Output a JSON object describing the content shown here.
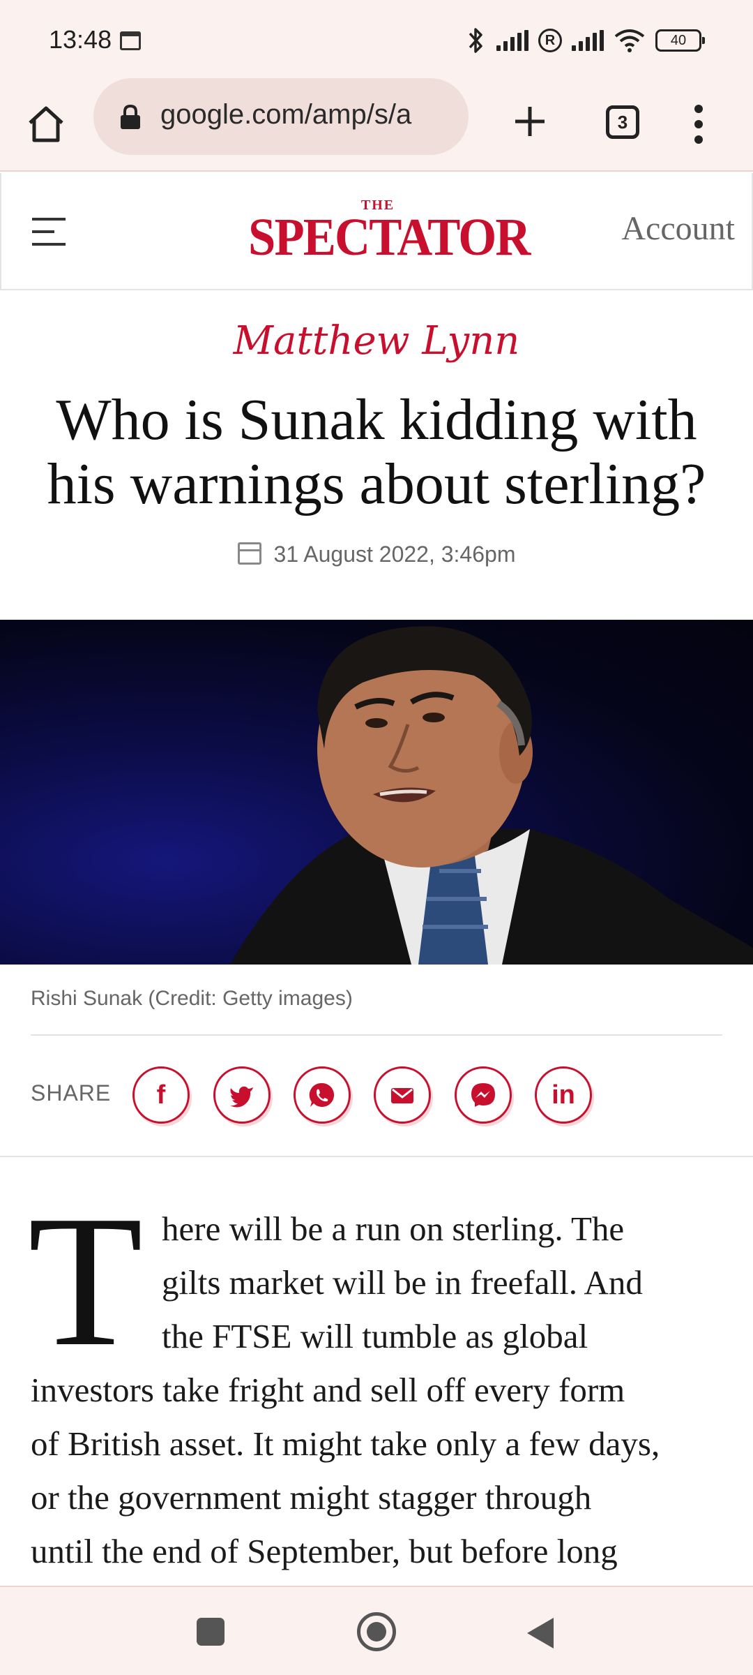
{
  "status_bar": {
    "time": "13:48",
    "battery": "40"
  },
  "browser": {
    "url": "google.com/amp/s/a",
    "tab_count": "3"
  },
  "site": {
    "logo_small": "THE",
    "logo_main": "SPECTATOR",
    "account": "Account",
    "brand_color": "#c8102e"
  },
  "article": {
    "author": "Matthew Lynn",
    "title_line1": "Who is Sunak kidding with",
    "title_line2": "his warnings about sterling?",
    "date": "31 August 2022, 3:46pm",
    "image_caption": "Rishi Sunak (Credit: Getty images)",
    "share_label": "SHARE",
    "share_buttons": [
      "facebook-icon",
      "twitter-icon",
      "whatsapp-icon",
      "email-icon",
      "messenger-icon",
      "linkedin-icon"
    ],
    "dropcap": "T",
    "body_lines": [
      "here will be a run on sterling. The",
      "gilts market will be in freefall. And",
      "the FTSE will tumble as global",
      "investors take fright and sell off every form",
      "of British asset. It might take only a few days,",
      "or the government might stagger through",
      "until the end of September, but before long"
    ]
  }
}
